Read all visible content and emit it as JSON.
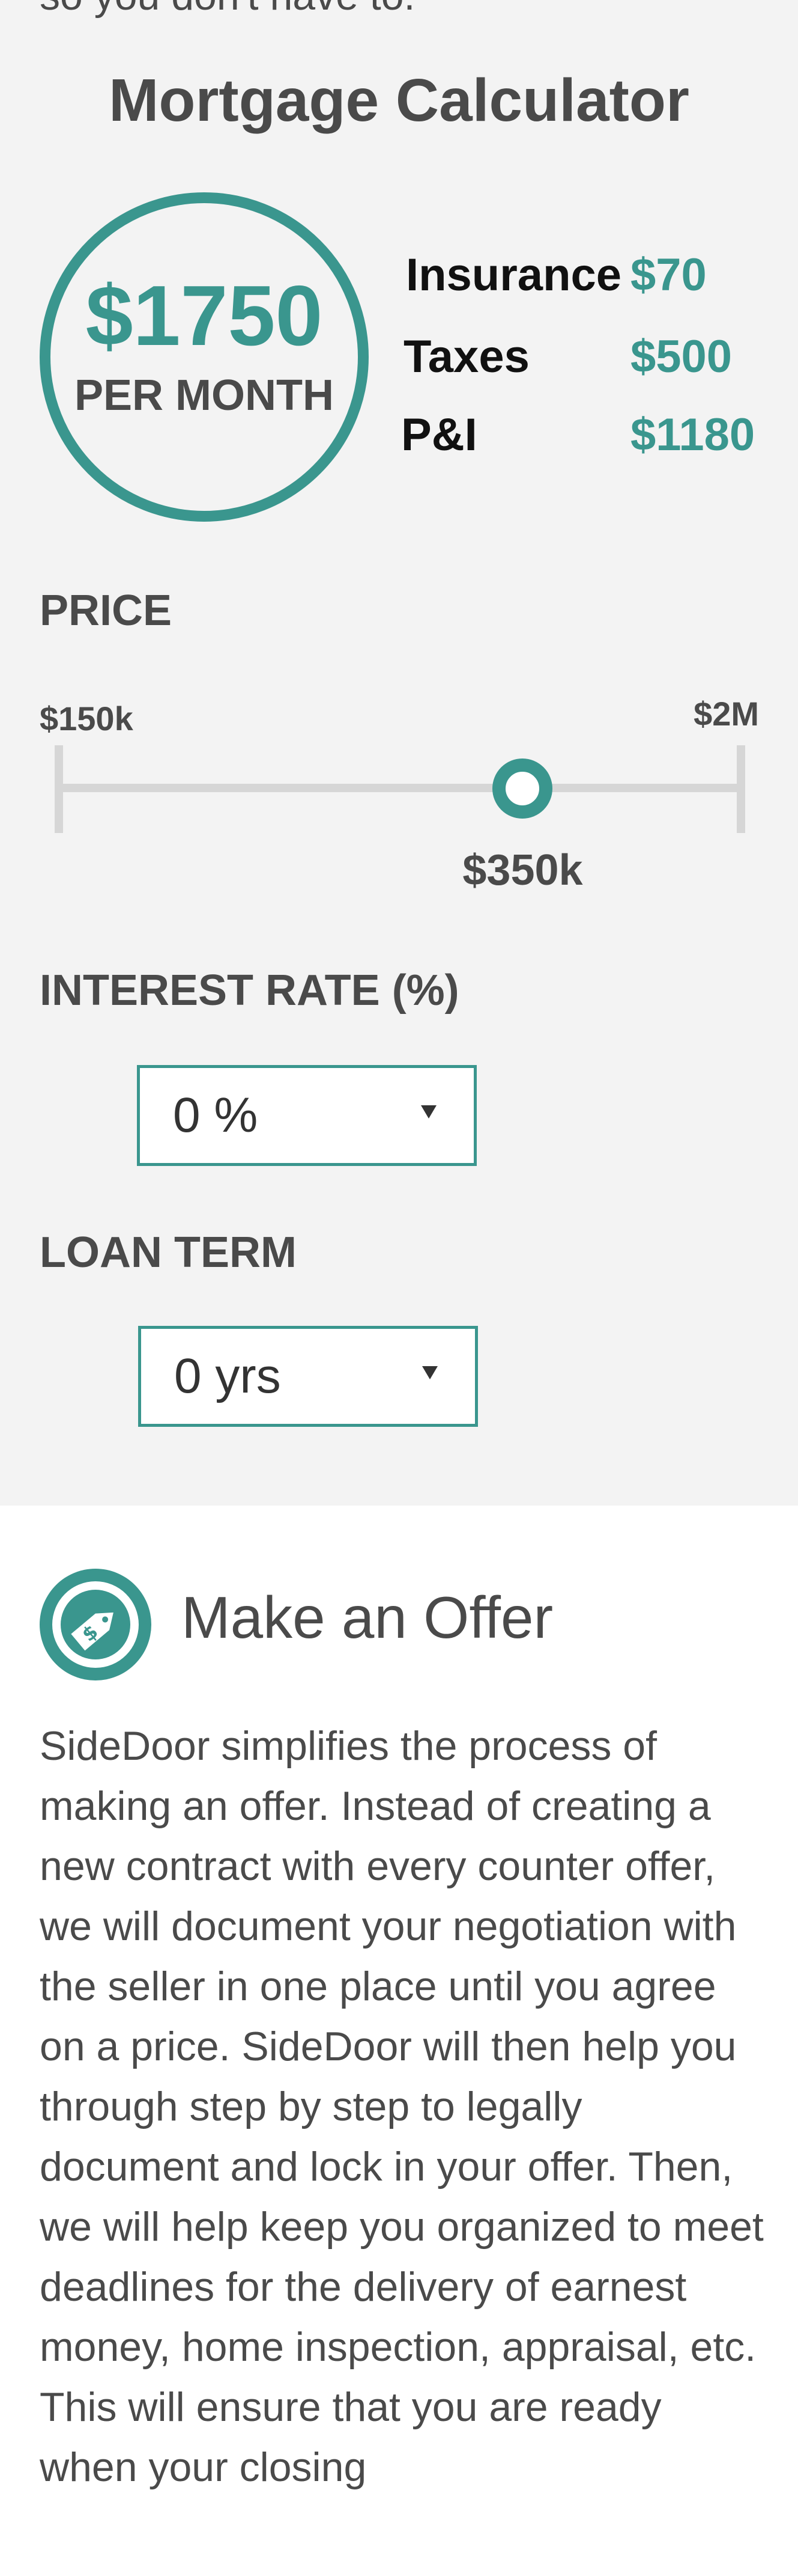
{
  "page": {
    "cut_off_text": "so you don't have to."
  },
  "calculator": {
    "title": "Mortgage Calculator",
    "monthly_amount": "$1750",
    "monthly_label": "PER MONTH",
    "breakdown": [
      {
        "label": "Insurance",
        "value": "$70"
      },
      {
        "label": "Taxes",
        "value": "$500"
      },
      {
        "label": "P&I",
        "value": "$1180"
      }
    ],
    "price": {
      "label": "PRICE",
      "min_label": "$150k",
      "max_label": "$2M",
      "value_label": "$350k",
      "slider_fraction": 0.68
    },
    "interest_rate": {
      "label": "INTEREST RATE (%)",
      "selected": "0 %"
    },
    "loan_term": {
      "label": "LOAN TERM",
      "selected": "0 yrs"
    }
  },
  "offer": {
    "icon": "price-tag-icon",
    "title": "Make an Offer",
    "body": "SideDoor simplifies the process of making an offer. Instead of creating a new contract with every counter offer, we will document your negotiation with the seller in one place until you agree on a price. SideDoor will then help you through step by step to legally document and lock in your offer. Then, we will help keep you organized to meet deadlines for the delivery of earnest money, home inspection, appraisal, etc. This will ensure that you are ready  when your closing"
  },
  "colors": {
    "accent": "#3a968e",
    "panel_background": "#f3f3f3",
    "text": "#4a4a4a"
  }
}
